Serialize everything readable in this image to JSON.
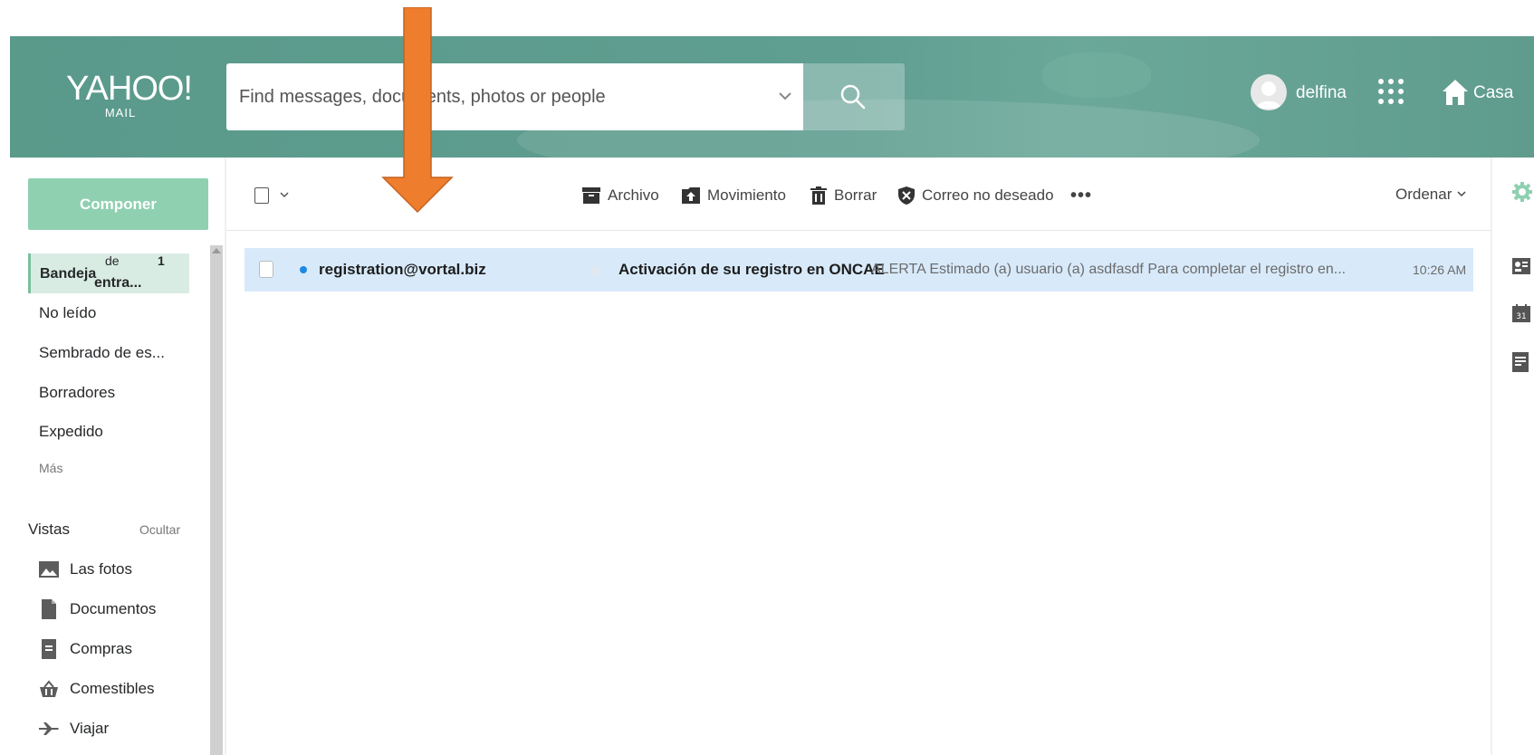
{
  "header": {
    "logo_line1": "YAHOO!",
    "logo_line2": "MAIL",
    "search_placeholder": "Find messages, documents, photos or people",
    "user_name": "delfina",
    "home_label": "Casa"
  },
  "sidebar": {
    "compose_label": "Componer",
    "inbox": {
      "label_a": "Bandeja",
      "label_b": "de",
      "label_c": "entra...",
      "count": "1"
    },
    "items": [
      "No leído",
      "Sembrado de es...",
      "Borradores",
      "Expedido"
    ],
    "more_label": "Más",
    "views_title": "Vistas",
    "views_hide": "Ocultar",
    "views": [
      {
        "label": "Las fotos",
        "icon": "photos-icon"
      },
      {
        "label": "Documentos",
        "icon": "document-icon"
      },
      {
        "label": "Compras",
        "icon": "receipt-icon"
      },
      {
        "label": "Comestibles",
        "icon": "basket-icon"
      },
      {
        "label": "Viajar",
        "icon": "plane-icon"
      }
    ]
  },
  "toolbar": {
    "archive": "Archivo",
    "move": "Movimiento",
    "delete": "Borrar",
    "spam": "Correo no deseado",
    "more": "•••",
    "sort": "Ordenar"
  },
  "messages": [
    {
      "from": "registration@vortal.biz",
      "subject": "Activación de su registro en ONCAE",
      "snippet": "ALERTA Estimado (a) usuario (a) asdfasdf Para completar el registro en...",
      "time": "10:26 AM",
      "unread": true
    }
  ],
  "colors": {
    "header": "#5f9e90",
    "compose": "#8fd0b1",
    "selected_row": "#d8eafa",
    "unread_dot": "#1e88e5",
    "annotation_arrow": "#ef7d2e"
  }
}
